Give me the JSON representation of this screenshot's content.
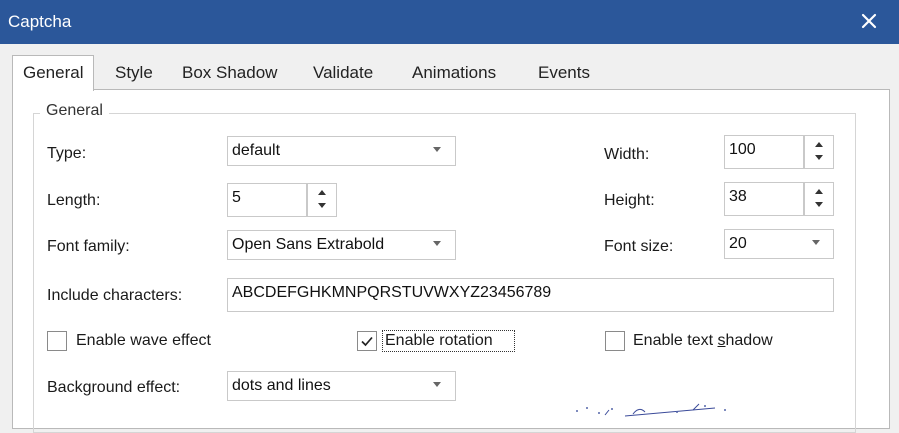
{
  "window": {
    "title": "Captcha"
  },
  "tabs": [
    {
      "label": "General",
      "active": true
    },
    {
      "label": "Style"
    },
    {
      "label": "Box Shadow"
    },
    {
      "label": "Validate"
    },
    {
      "label": "Animations"
    },
    {
      "label": "Events"
    }
  ],
  "group": {
    "legend": "General"
  },
  "fields": {
    "type": {
      "label": "Type:",
      "value": "default"
    },
    "length": {
      "label": "Length:",
      "value": "5"
    },
    "font_family": {
      "label": "Font family:",
      "value": "Open Sans Extrabold"
    },
    "include_chars": {
      "label": "Include characters:",
      "value": "ABCDEFGHKMNPQRSTUVWXYZ23456789"
    },
    "width": {
      "label": "Width:",
      "value": "100"
    },
    "height": {
      "label": "Height:",
      "value": "38"
    },
    "font_size": {
      "label": "Font size:",
      "value": "20"
    },
    "background_effect": {
      "label": "Background effect:",
      "value": "dots and lines"
    }
  },
  "checkboxes": {
    "wave": {
      "label": "Enable wave effect",
      "checked": false
    },
    "rotation": {
      "label": "Enable rotation",
      "checked": true
    },
    "text_shadow": {
      "label_pre": "Enable text ",
      "label_accel": "s",
      "label_post": "hadow",
      "checked": false
    }
  },
  "colors": {
    "titlebar": "#2b579a",
    "accent": "#2b579a"
  },
  "icons": {
    "close": "close-icon",
    "check": "check-icon"
  }
}
